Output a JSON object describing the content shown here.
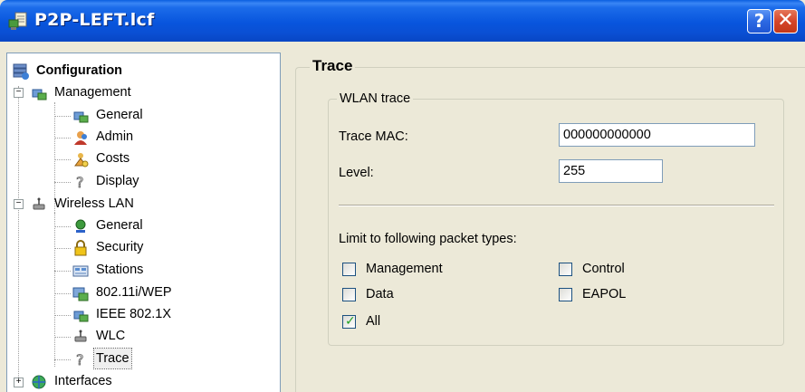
{
  "window": {
    "title": "P2P-LEFT.lcf",
    "help_label": "?",
    "close_label": "✕"
  },
  "tree": {
    "root": "Configuration",
    "management": {
      "label": "Management",
      "children": [
        "General",
        "Admin",
        "Costs",
        "Display"
      ]
    },
    "wireless_lan": {
      "label": "Wireless LAN",
      "children": [
        "General",
        "Security",
        "Stations",
        "802.11i/WEP",
        "IEEE 802.1X",
        "WLC",
        "Trace"
      ]
    },
    "interfaces": {
      "label": "Interfaces"
    },
    "selected": "Trace"
  },
  "panel": {
    "title": "Trace",
    "group_title": "WLAN trace",
    "trace_mac_label": "Trace MAC:",
    "trace_mac_value": "000000000000",
    "level_label": "Level:",
    "level_value": "255",
    "limit_label": "Limit to following packet types:",
    "checkboxes": {
      "management": {
        "label": "Management",
        "checked": false
      },
      "control": {
        "label": "Control",
        "checked": false
      },
      "data": {
        "label": "Data",
        "checked": false
      },
      "eapol": {
        "label": "EAPOL",
        "checked": false
      },
      "all": {
        "label": "All",
        "checked": true
      }
    }
  },
  "colors": {
    "titlebar": "#0855DD",
    "dialog_bg": "#ECE9D8",
    "close_red": "#D5452A"
  }
}
